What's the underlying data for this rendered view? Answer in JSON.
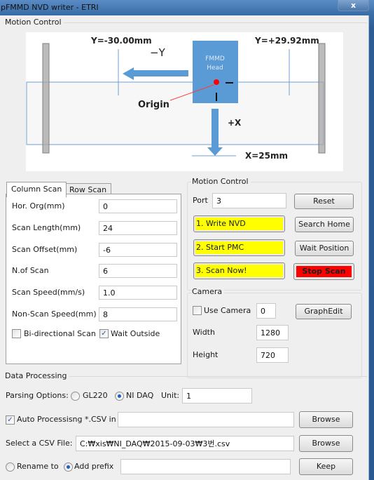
{
  "window": {
    "title": "pFMMD NVD writer - ETRI",
    "close_label": "x"
  },
  "motion_section": {
    "title": "Motion Control"
  },
  "diagram": {
    "label_y_neg": "Y=-30.00mm",
    "label_y_pos": "Y=+29.92mm",
    "label_neg_y_arrow": "−Y",
    "head_line1": "FMMD",
    "head_line2": "Head",
    "origin_label": "Origin",
    "plus_x_label": "+X",
    "x_limit_label": "X=25mm",
    "colors": {
      "head": "#5b9bd5",
      "origin_dot": "#ff0000",
      "rail": "#a6a6a6"
    }
  },
  "scan_tabs": {
    "tabs": [
      {
        "label": "Column Scan",
        "active": true
      },
      {
        "label": "Row Scan",
        "active": false
      }
    ],
    "fields": [
      {
        "label": "Hor. Org(mm)",
        "value": "0"
      },
      {
        "label": "Scan Length(mm)",
        "value": "24"
      },
      {
        "label": "Scan Offset(mm)",
        "value": "-6"
      },
      {
        "label": "N.of Scan",
        "value": "6"
      },
      {
        "label": "Scan Speed(mm/s)",
        "value": "1.0"
      },
      {
        "label": "Non-Scan Speed(mm)",
        "value": "8"
      }
    ],
    "bidirectional": {
      "label": "Bi-directional Scan",
      "checked": false
    },
    "wait_outside": {
      "label": "Wait Outside",
      "checked": true
    }
  },
  "motion_control": {
    "title": "Motion Control",
    "port_label": "Port",
    "port_value": "3",
    "reset_label": "Reset",
    "search_home_label": "Search Home",
    "wait_position_label": "Wait Position",
    "stop_scan_label": "Stop Scan",
    "write_nvd_label": "1. Write NVD",
    "start_pmc_label": "2. Start PMC",
    "scan_now_label": "3. Scan Now!",
    "colors": {
      "step_highlight": "#ffff00",
      "stop": "#ff0000"
    }
  },
  "camera": {
    "title": "Camera",
    "use_camera_label": "Use Camera",
    "use_camera_checked": false,
    "camera_index": "0",
    "graphedit_label": "GraphEdit",
    "width_label": "Width",
    "width_value": "1280",
    "height_label": "Height",
    "height_value": "720"
  },
  "data_processing": {
    "title": "Data Processing",
    "parsing_label": "Parsing Options:",
    "option_gl220": "GL220",
    "option_nidaq": "NI DAQ",
    "selected_option": "NI DAQ",
    "unit_label": "Unit:",
    "unit_value": "1",
    "auto_label": "Auto Processisng *.CSV in",
    "auto_checked": true,
    "auto_path": "",
    "browse_label": "Browse",
    "select_csv_label": "Select a CSV File:",
    "csv_path": "C:₩xis₩NI_DAQ₩2015-09-03₩3번.csv",
    "browse2_label": "Browse",
    "rename_label": "Rename to",
    "prefix_label": "Add prefix",
    "selected_naming": "Add prefix",
    "prefix_value": "",
    "keep_label": "Keep"
  }
}
